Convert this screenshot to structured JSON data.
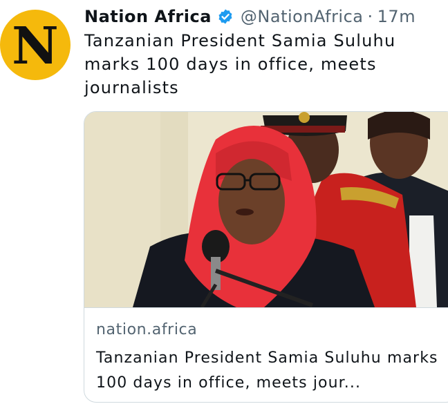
{
  "account": {
    "avatar_letter": "N",
    "avatar_color": "#f5b90c",
    "name": "Nation Africa",
    "handle": "@NationAfrica",
    "separator": "·",
    "time": "17m",
    "verified_color": "#1d9bf0"
  },
  "tweet": {
    "text": "Tanzanian President Samia Suluhu marks 100 days in office, meets journalists"
  },
  "card": {
    "domain": "nation.africa",
    "title": "Tanzanian President Samia Suluhu marks 100 days in office, meets jour..."
  }
}
